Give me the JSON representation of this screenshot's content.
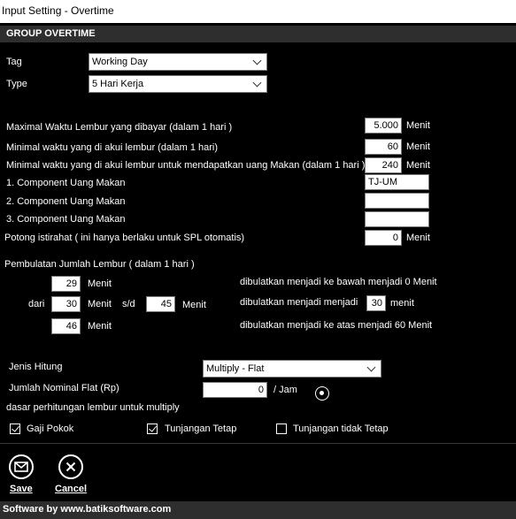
{
  "window": {
    "title": "Input Setting - Overtime"
  },
  "group": {
    "title": "GROUP OVERTIME"
  },
  "tag": {
    "label": "Tag",
    "value": "Working Day"
  },
  "type": {
    "label": "Type",
    "value": "5 Hari Kerja"
  },
  "fields": {
    "max_waktu": {
      "label": "Maximal Waktu Lembur yang dibayar  (dalam 1 hari )",
      "value": "5.000",
      "unit": "Menit"
    },
    "min_waktu": {
      "label": "Minimal waktu  yang di akui lembur (dalam 1 hari)",
      "value": "60",
      "unit": "Menit"
    },
    "min_waktu_makan": {
      "label": "Minimal waktu  yang di akui lembur untuk mendapatkan uang Makan (dalam 1 hari )",
      "value": "240",
      "unit": "Menit"
    },
    "comp1": {
      "label": "1. Component Uang Makan",
      "value": "TJ-UM"
    },
    "comp2": {
      "label": "2. Component Uang Makan",
      "value": ""
    },
    "comp3": {
      "label": "3. Component Uang Makan",
      "value": ""
    },
    "potong": {
      "label": "Potong istirahat ( ini hanya berlaku untuk SPL otomatis)",
      "value": "0",
      "unit": "Menit"
    }
  },
  "pembulatan": {
    "title": "Pembulatan Jumlah Lembur ( dalam 1 hari )",
    "dari_label": "dari",
    "sd_label": "s/d",
    "row1": {
      "value": "29",
      "unit": "Menit",
      "desc": "dibulatkan menjadi ke bawah menjadi 0 Menit"
    },
    "row2": {
      "value": "30",
      "unit": "Menit",
      "to_value": "45",
      "to_unit": "Menit",
      "desc": "dibulatkan menjadi  menjadi",
      "result_value": "30",
      "result_unit": "menit"
    },
    "row3": {
      "value": "46",
      "unit": "Menit",
      "desc": "dibulatkan menjadi ke atas menjadi 60 Menit"
    }
  },
  "jenis_hitung": {
    "label": "Jenis Hitung",
    "value": "Multiply - Flat"
  },
  "nominal_flat": {
    "label": "Jumlah Nominal Flat  (Rp)",
    "value": "0",
    "unit": "/ Jam"
  },
  "dasar": {
    "label": "dasar perhitungan lembur untuk multiply",
    "options": [
      {
        "label": "Gaji Pokok",
        "checked": true
      },
      {
        "label": "Tunjangan Tetap",
        "checked": true
      },
      {
        "label": "Tunjangan tidak Tetap",
        "checked": false
      }
    ]
  },
  "actions": {
    "save_label": "Save",
    "cancel_label": "Cancel"
  },
  "footer": {
    "text": "Software by www.batiksoftware.com"
  }
}
